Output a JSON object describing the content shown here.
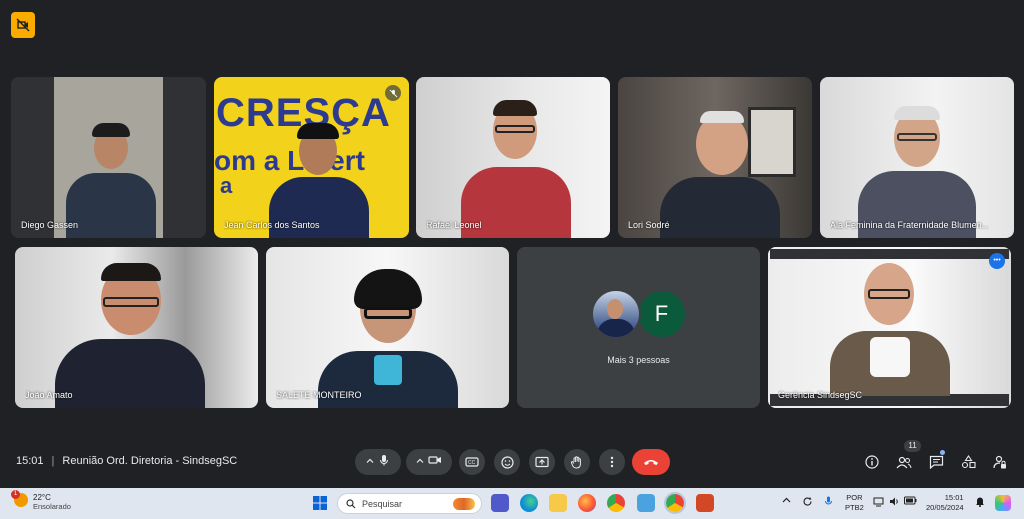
{
  "meeting": {
    "time": "15:01",
    "separator": "|",
    "title": "Reunião Ord. Diretoria - SindsegSC",
    "participants_count": "11"
  },
  "tiles": [
    {
      "name": "Diego Gassen"
    },
    {
      "name": "Jean Carlos dos Santos",
      "banner_line1": "CRESÇA",
      "banner_line2": "om a Libert",
      "banner_line3": "a"
    },
    {
      "name": "Rafael Leonel"
    },
    {
      "name": "Lori Sodré"
    },
    {
      "name": "Ala Feminina da Fraternidade Blumen..."
    },
    {
      "name": "João Amato"
    },
    {
      "name": "SALETE MONTEIRO"
    },
    {
      "name": "Gerência SindsegSC"
    }
  ],
  "others": {
    "label": "Mais 3 pessoas",
    "avatar_letter": "F",
    "avatar_color": "#0b5a3c"
  },
  "controls": {
    "more_dots": "•••"
  },
  "taskbar": {
    "temperature": "22°C",
    "weather": "Ensolarado",
    "weather_badge": "1",
    "search_placeholder": "Pesquisar",
    "lang_line1": "POR",
    "lang_line2": "PTB2",
    "clock_time": "15:01",
    "clock_date": "20/05/2024"
  },
  "colors": {
    "background": "#202124",
    "tile": "#3c4043",
    "accent_blue": "#8ab4f8",
    "end_call": "#ea4335",
    "meet_badge": "#f9ab00"
  }
}
